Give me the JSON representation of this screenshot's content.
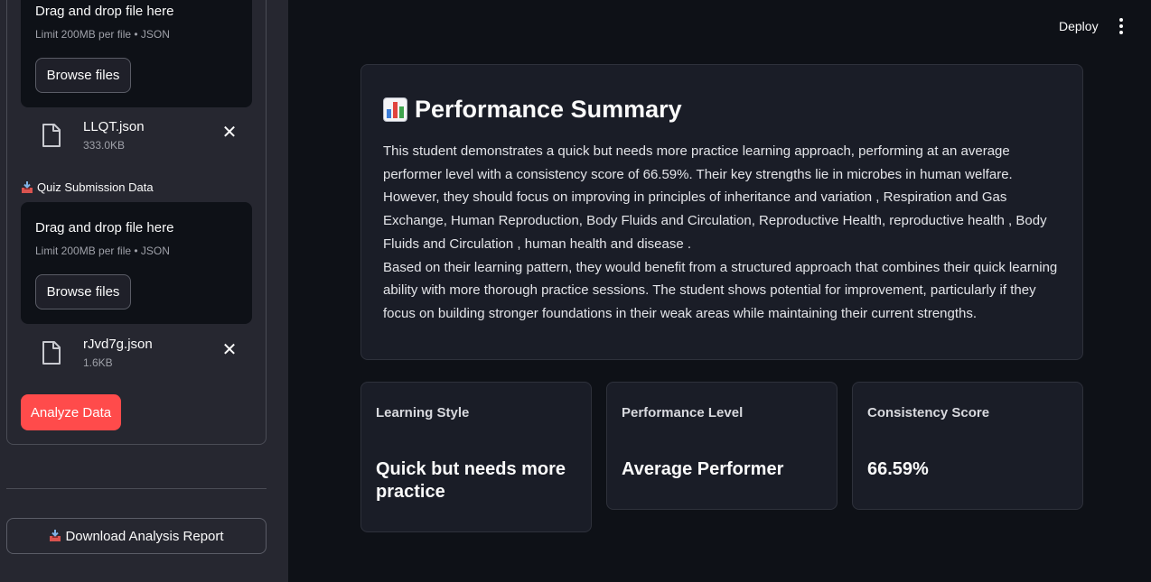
{
  "header": {
    "deploy_label": "Deploy"
  },
  "sidebar": {
    "upload1": {
      "drop_title": "Drag and drop file here",
      "drop_sub": "Limit 200MB per file • JSON",
      "browse_label": "Browse files",
      "file_name": "LLQT.json",
      "file_size": "333.0KB"
    },
    "quiz_label": "Quiz Submission Data",
    "upload2": {
      "drop_title": "Drag and drop file here",
      "drop_sub": "Limit 200MB per file • JSON",
      "browse_label": "Browse files",
      "file_name": "rJvd7g.json",
      "file_size": "1.6KB"
    },
    "analyze_label": "Analyze Data",
    "download_label": "Download Analysis Report"
  },
  "summary": {
    "title": "Performance Summary",
    "paragraph1": "This student demonstrates a quick but needs more practice learning approach, performing at an average performer level with a consistency score of 66.59%. Their key strengths lie in microbes in human welfare. However, they should focus on improving in principles of inheritance and variation , Respiration and Gas Exchange, Human Reproduction, Body Fluids and Circulation, Reproductive Health, reproductive health , Body Fluids and Circulation , human health and disease .",
    "paragraph2": "Based on their learning pattern, they would benefit from a structured approach that combines their quick learning ability with more thorough practice sessions. The student shows potential for improvement, particularly if they focus on building stronger foundations in their weak areas while maintaining their current strengths."
  },
  "metrics": [
    {
      "label": "Learning Style",
      "value": "Quick but needs more practice"
    },
    {
      "label": "Performance Level",
      "value": "Average Performer"
    },
    {
      "label": "Consistency Score",
      "value": "66.59%"
    }
  ],
  "colors": {
    "background": "#0e1117",
    "sidebar": "#262730",
    "primary": "#ff4b4b",
    "card": "#1a1d27"
  }
}
